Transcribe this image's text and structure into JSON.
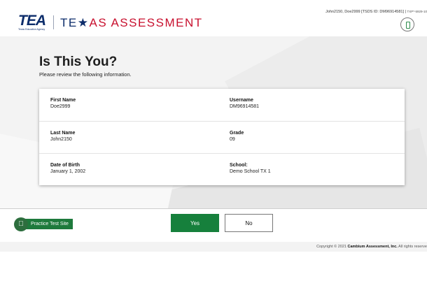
{
  "header": {
    "tea_logo_text": "TEA",
    "tea_logo_subtext": "Texas Education Agency",
    "brand_te": "TE",
    "brand_star": "★",
    "brand_rest": "AS ASSESSMENT",
    "user_info": "John2150, Doe2999 [TSDS ID: DM96914581] | ",
    "session_tag": "TXP*-5929-10",
    "avatar_icon": "tablet-icon"
  },
  "main": {
    "title": "Is This You?",
    "subtitle": "Please review the following information."
  },
  "card": {
    "rows": [
      {
        "left_label": "First Name",
        "left_value": "Doe2999",
        "right_label": "Username",
        "right_value": "DM96914581"
      },
      {
        "left_label": "Last Name",
        "left_value": "John2150",
        "right_label": "Grade",
        "right_value": "09"
      },
      {
        "left_label": "Date of Birth",
        "left_value": "January 1, 2002",
        "right_label": "School:",
        "right_value": "Demo School TX 1"
      }
    ]
  },
  "footer": {
    "practice_label": "Practice Test Site",
    "practice_icon": "apple-icon",
    "yes_label": "Yes",
    "no_label": "No",
    "copyright_prefix": "Copyright © 2021 ",
    "copyright_company": "Cambium Assessment, Inc.",
    "copyright_suffix": " All rights reserve"
  },
  "colors": {
    "brand_navy": "#0d2d6b",
    "brand_red": "#c8102e",
    "primary_green": "#16803c"
  }
}
